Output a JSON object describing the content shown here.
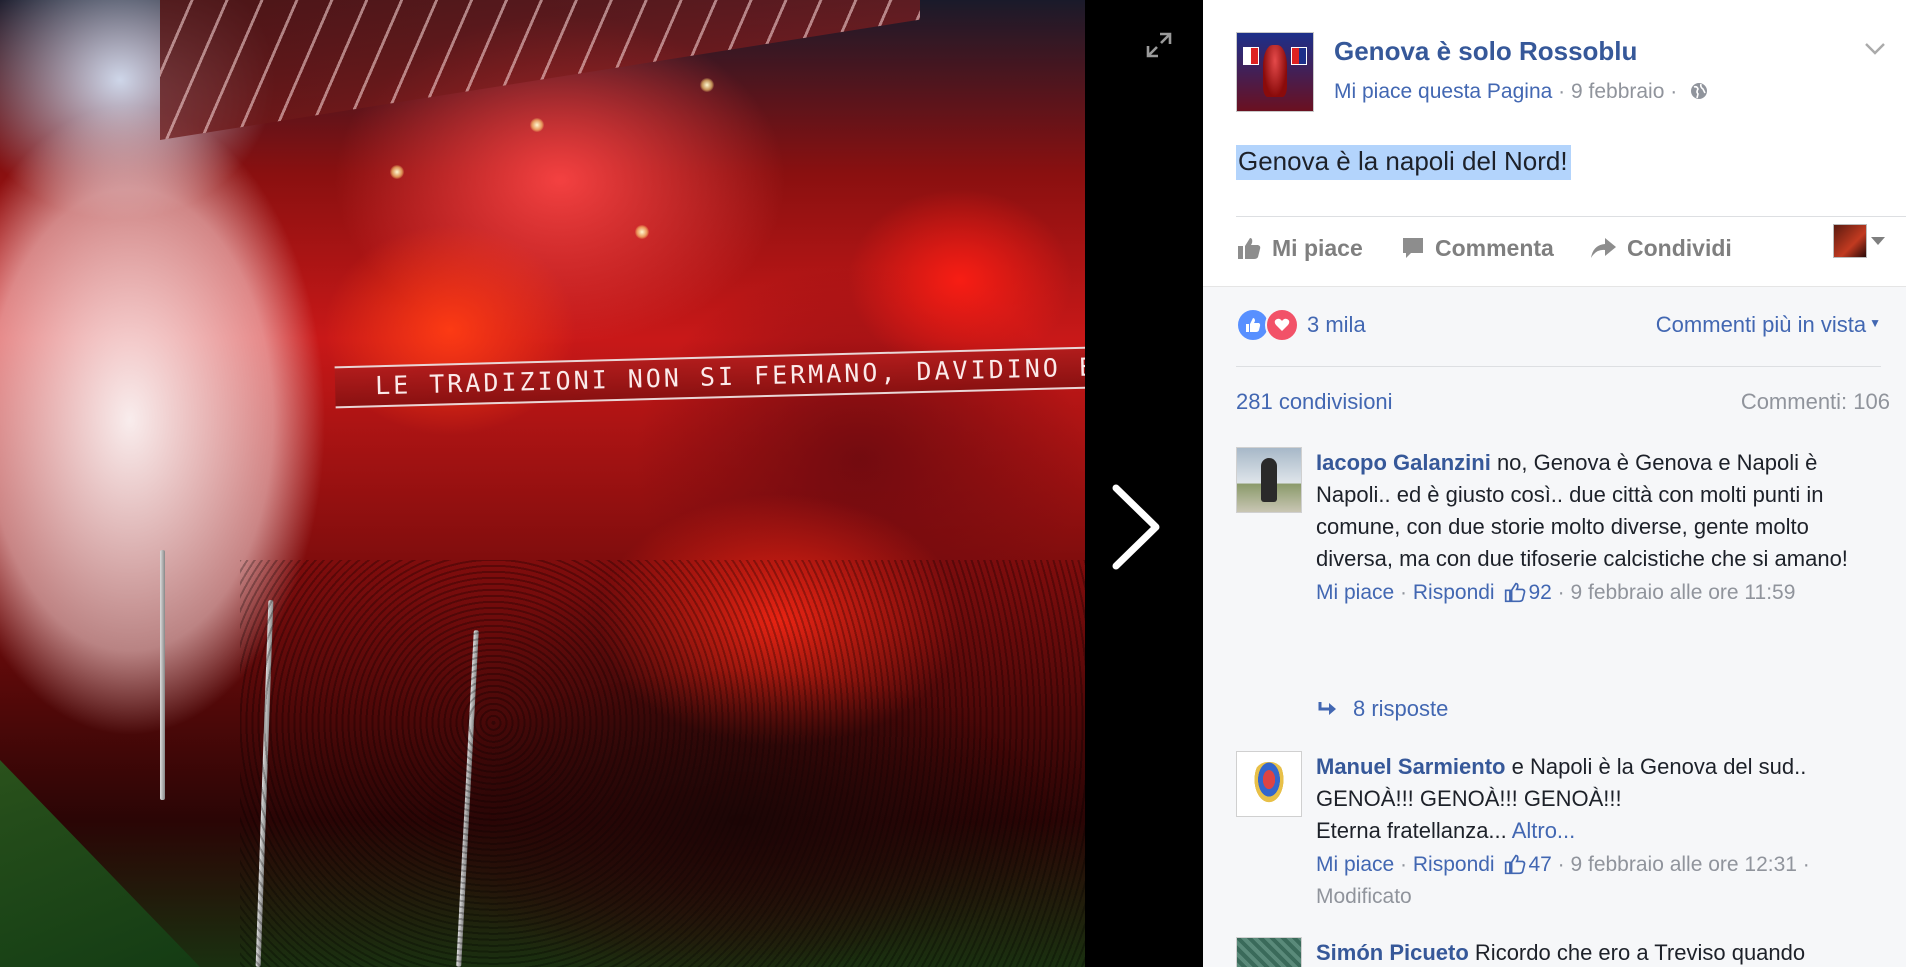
{
  "photo": {
    "banner_text": "LE TRADIZIONI NON SI FERMANO, DAVIDINO E' DEDICATO A TE!"
  },
  "post": {
    "page_name": "Genova è solo Rossoblu",
    "like_page": "Mi piace questa Pagina",
    "sep": "·",
    "date": "9 febbraio",
    "text": "Genova è la napoli del Nord!"
  },
  "actions": {
    "like": "Mi piace",
    "comment": "Commenta",
    "share": "Condividi"
  },
  "stats": {
    "reactions_count": "3 mila",
    "sort_label": "Commenti più in vista",
    "shares": "281 condivisioni",
    "comments": "Commenti: 106"
  },
  "comments": [
    {
      "author": "Iacopo Galanzini",
      "text": "no, Genova è Genova e Napoli è Napoli.. ed è giusto così.. due città con molti punti in comune, con due storie molto diverse, gente molto diversa, ma con due tifoserie calcistiche che si amano!",
      "like": "Mi piace",
      "reply": "Rispondi",
      "likes": "92",
      "time": "9 febbraio alle ore 11:59",
      "replies": "8 risposte"
    },
    {
      "author": "Manuel Sarmiento",
      "text": "e Napoli è la Genova del sud.. GENOÀ!!! GENOÀ!!! GENOÀ!!!",
      "text2": "Eterna fratellanza...",
      "more": "Altro...",
      "like": "Mi piace",
      "reply": "Rispondi",
      "likes": "47",
      "time": "9 febbraio alle ore 12:31",
      "edited": "Modificato"
    },
    {
      "author": "Simón Picueto",
      "text": "Ricordo che ero a Treviso quando"
    }
  ],
  "colors": {
    "link_blue": "#365899",
    "meta_grey": "#90949c",
    "selection": "#b3d4fc"
  }
}
